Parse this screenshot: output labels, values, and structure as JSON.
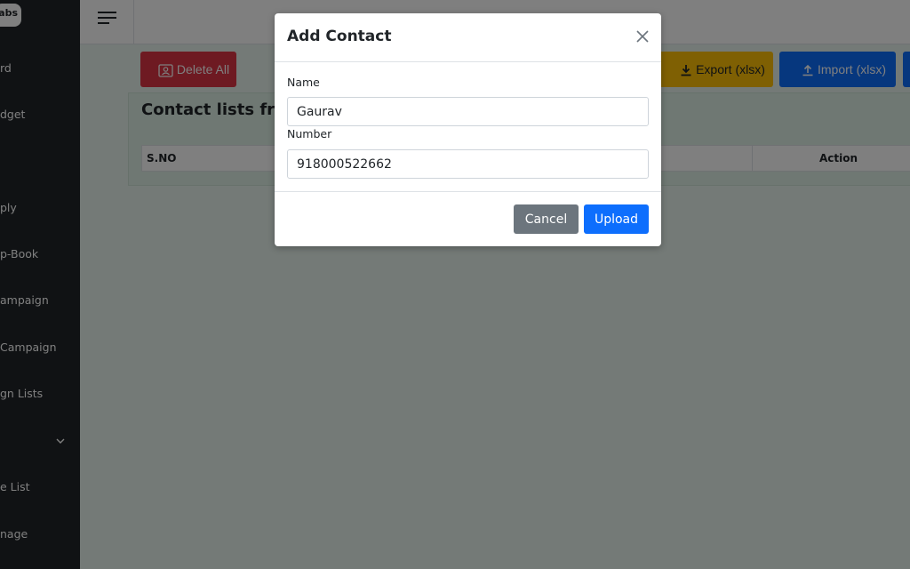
{
  "sidebar": {
    "logo_text": "abs",
    "items": [
      {
        "label": "rd"
      },
      {
        "label": "dget"
      },
      {
        "label": "ply"
      },
      {
        "label": "p-Book"
      },
      {
        "label": "ampaign"
      },
      {
        "label": " Campaign"
      },
      {
        "label": "gn Lists"
      },
      {
        "label": "e List"
      },
      {
        "label": "nage"
      }
    ]
  },
  "toolbar": {
    "delete_all_label": "Delete All",
    "export_label": "Export (xlsx)",
    "import_label": "Import (xlsx)"
  },
  "card": {
    "title": "Contact lists from",
    "columns": [
      "S.NO",
      "Action"
    ]
  },
  "modal": {
    "title": "Add Contact",
    "name_label": "Name",
    "name_value": "Gaurav",
    "number_label": "Number",
    "number_value": "918000522662",
    "cancel_label": "Cancel",
    "upload_label": "Upload"
  },
  "colors": {
    "sidebar_bg": "#212529",
    "danger": "#dc3545",
    "warning": "#ffc107",
    "primary": "#0d6efd",
    "secondary": "#6c757d"
  },
  "icons": {
    "menu": "hamburger-icon",
    "delete": "contact-card-icon",
    "export": "download-icon",
    "import": "upload-icon",
    "close": "close-icon",
    "expand": "chevron-down-icon"
  }
}
